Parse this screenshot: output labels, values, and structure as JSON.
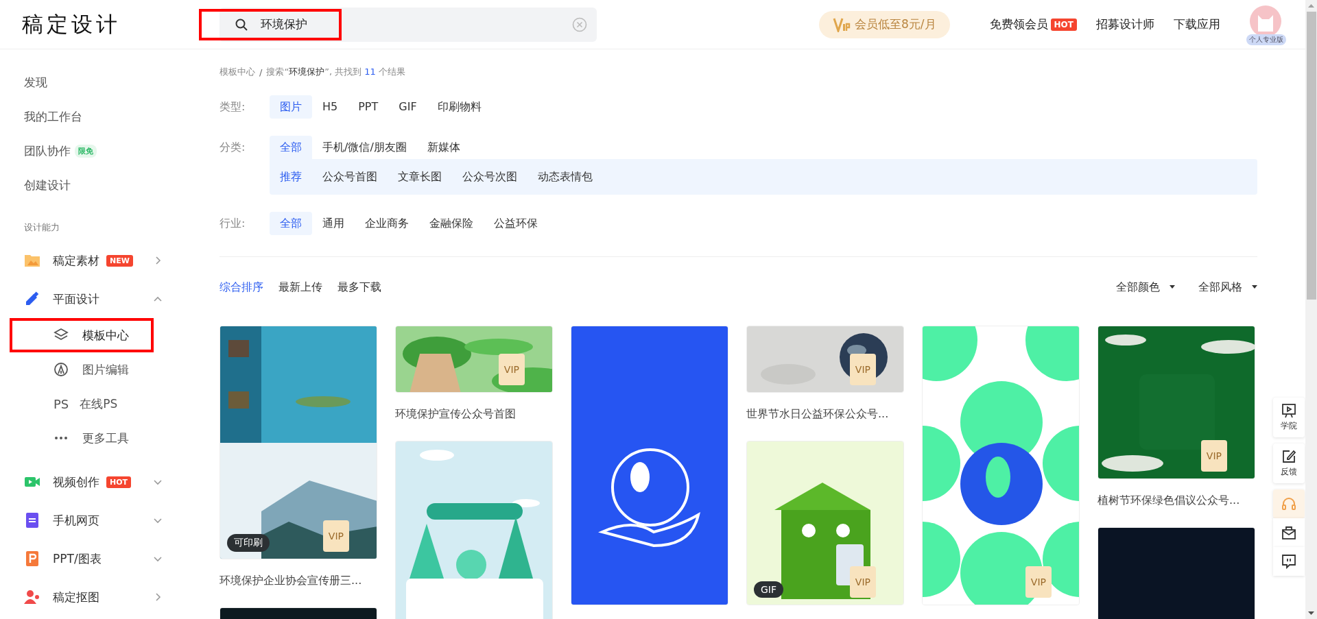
{
  "header": {
    "logo": "稿定设计",
    "search": {
      "value": "环境保护",
      "highlight": true
    },
    "vip_offer": "会员低至8元/月",
    "nav": [
      {
        "label": "免费领会员",
        "badge": "HOT"
      },
      {
        "label": "招募设计师"
      },
      {
        "label": "下载应用"
      }
    ],
    "avatar_label": "个人专业版"
  },
  "sidebar": {
    "items": [
      {
        "label": "发现"
      },
      {
        "label": "我的工作台"
      },
      {
        "label": "团队协作",
        "badge": {
          "text": "限免",
          "kind": "free"
        }
      },
      {
        "label": "创建设计"
      }
    ],
    "section_title": "设计能力",
    "groups": [
      {
        "label": "稿定素材",
        "badge": {
          "text": "NEW",
          "kind": "hot"
        },
        "kind": "link"
      },
      {
        "label": "平面设计",
        "kind": "menu",
        "expanded": true,
        "children": [
          {
            "label": "模板中心",
            "selected": true,
            "highlight": true
          },
          {
            "label": "图片编辑",
            "selected": false,
            "highlight": false
          },
          {
            "label": "在线PS",
            "icon_text": "PS",
            "selected": false,
            "highlight": false
          },
          {
            "label": "更多工具",
            "selected": false,
            "highlight": false
          }
        ]
      },
      {
        "label": "视频创作",
        "badge": {
          "text": "HOT",
          "kind": "hot"
        },
        "kind": "menu",
        "expanded": false
      },
      {
        "label": "手机网页",
        "kind": "menu",
        "expanded": false
      },
      {
        "label": "PPT/图表",
        "kind": "menu",
        "expanded": false
      },
      {
        "label": "稿定抠图",
        "kind": "link"
      }
    ]
  },
  "breadcrumb": {
    "root": "模板中心",
    "separator": "/",
    "prefix": "搜索“**环境保护**”, 共找到",
    "count": "11",
    "suffix": "个结果"
  },
  "filters": [
    {
      "label": "类型:",
      "options": [
        {
          "text": "图片",
          "selected": true
        },
        {
          "text": "H5",
          "selected": false
        },
        {
          "text": "PPT",
          "selected": false
        },
        {
          "text": "GIF",
          "selected": false
        },
        {
          "text": "印刷物料",
          "selected": false
        }
      ]
    },
    {
      "label": "分类:",
      "options": [
        {
          "text": "全部",
          "selected": true
        },
        {
          "text": "手机/微信/朋友圈",
          "selected": false
        },
        {
          "text": "新媒体",
          "selected": false
        }
      ],
      "sub_options": [
        {
          "text": "推荐",
          "selected": true
        },
        {
          "text": "公众号首图",
          "selected": false
        },
        {
          "text": "文章长图",
          "selected": false
        },
        {
          "text": "公众号次图",
          "selected": false
        },
        {
          "text": "动态表情包",
          "selected": false
        }
      ]
    },
    {
      "label": "行业:",
      "options": [
        {
          "text": "全部",
          "selected": true
        },
        {
          "text": "通用",
          "selected": false
        },
        {
          "text": "企业商务",
          "selected": false
        },
        {
          "text": "金融保险",
          "selected": false
        },
        {
          "text": "公益环保",
          "selected": false
        }
      ]
    }
  ],
  "sort_tabs": [
    {
      "text": "综合排序",
      "selected": true
    },
    {
      "text": "最新上传",
      "selected": false
    },
    {
      "text": "最多下载",
      "selected": false
    }
  ],
  "dropdowns": [
    "全部颜色",
    "全部风格"
  ],
  "results": [
    [
      {
        "kind": "picture",
        "title": "环境保护企业协会宣传册三...",
        "badges": [
          {
            "kind": "tag",
            "text": "可印刷"
          },
          {
            "kind": "vip",
            "text": "VIP"
          }
        ]
      },
      {
        "kind": "picture"
      }
    ],
    [
      {
        "kind": "picture",
        "title": "环境保护宣传公众号首图",
        "badges": [
          {
            "kind": "vip",
            "text": "VIP"
          }
        ]
      },
      {
        "kind": "picture"
      }
    ],
    [
      {
        "kind": "picture"
      }
    ],
    [
      {
        "kind": "picture",
        "title": "世界节水日公益环保公众号...",
        "badges": [
          {
            "kind": "vip",
            "text": "VIP"
          }
        ]
      },
      {
        "kind": "picture",
        "badges": [
          {
            "kind": "tag",
            "text": "GIF"
          },
          {
            "kind": "vip",
            "text": "VIP"
          }
        ]
      }
    ],
    [
      {
        "kind": "picture",
        "badges": [
          {
            "kind": "vip",
            "text": "VIP"
          }
        ]
      }
    ],
    [
      {
        "kind": "picture",
        "title": "植树节环保绿色倡议公众号...",
        "badges": [
          {
            "kind": "vip",
            "text": "VIP"
          }
        ]
      },
      {
        "kind": "picture"
      }
    ]
  ],
  "float_tools": [
    {
      "label": "学院",
      "highlighted": false
    },
    {
      "label": "反馈",
      "highlighted": false
    },
    {
      "highlighted": true
    },
    {
      "highlighted": false
    },
    {
      "highlighted": false
    }
  ]
}
